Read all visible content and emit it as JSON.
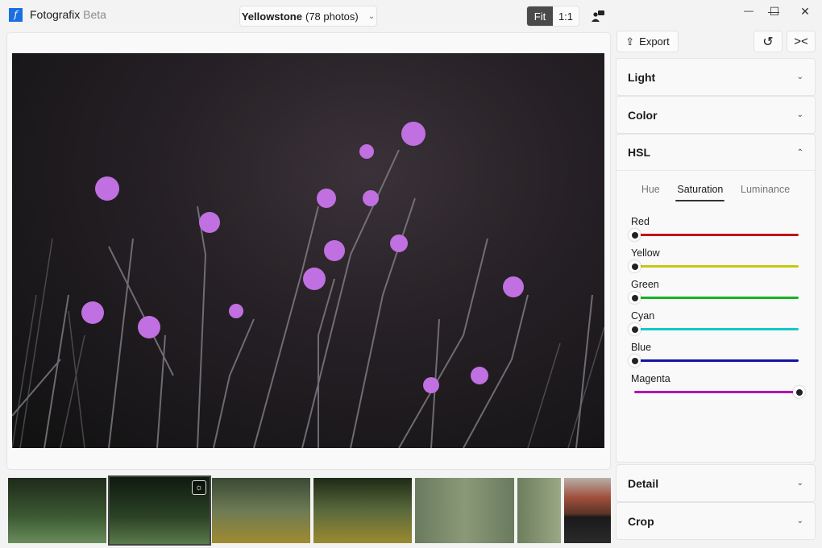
{
  "app": {
    "name": "Fotografix",
    "edition": "Beta"
  },
  "album": {
    "name": "Yellowstone",
    "count": "(78 photos)"
  },
  "zoom": {
    "options": [
      "Fit",
      "1:1"
    ],
    "selected": "Fit"
  },
  "window": {
    "minimize": "—",
    "maximize": "☐",
    "close": "✕"
  },
  "toolbar": {
    "export": "Export"
  },
  "panels": {
    "light": "Light",
    "color": "Color",
    "hsl": "HSL",
    "detail": "Detail",
    "crop": "Crop"
  },
  "hsl": {
    "tabs": [
      "Hue",
      "Saturation",
      "Luminance"
    ],
    "active_tab": "Saturation",
    "sliders": [
      {
        "label": "Red",
        "color": "#c0141c",
        "value": 0
      },
      {
        "label": "Yellow",
        "color": "#c8c814",
        "value": 0
      },
      {
        "label": "Green",
        "color": "#14b41e",
        "value": 0
      },
      {
        "label": "Cyan",
        "color": "#14c8c8",
        "value": 0
      },
      {
        "label": "Blue",
        "color": "#1414a0",
        "value": 0
      },
      {
        "label": "Magenta",
        "color": "#b414b4",
        "value": 1
      }
    ]
  },
  "filmstrip": {
    "count": 7,
    "selected_index": 1
  }
}
